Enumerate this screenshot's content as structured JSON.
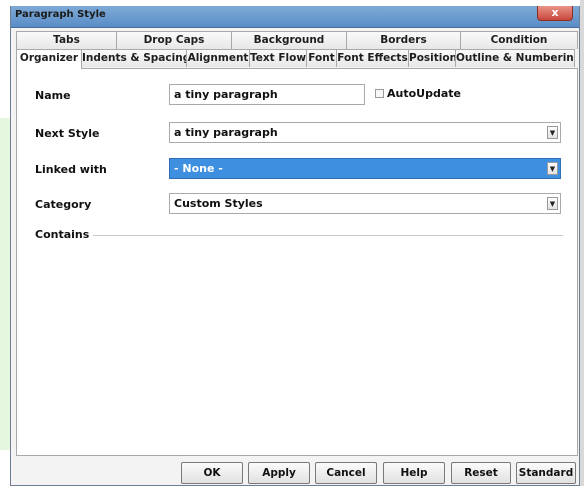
{
  "window": {
    "title": "Paragraph Style",
    "close_label": "x"
  },
  "tabs": {
    "back_row": [
      "Tabs",
      "Drop Caps",
      "Background",
      "Borders",
      "Condition"
    ],
    "front_row": [
      "Organizer",
      "Indents & Spacing",
      "Alignment",
      "Text Flow",
      "Font",
      "Font Effects",
      "Position",
      "Outline & Numbering"
    ],
    "active": "Organizer"
  },
  "form": {
    "name_label": "Name",
    "name_value": "a tiny paragraph",
    "autoupdate_label": "AutoUpdate",
    "autoupdate_checked": false,
    "next_style_label": "Next Style",
    "next_style_value": "a tiny paragraph",
    "linked_with_label": "Linked with",
    "linked_with_value": "- None -",
    "category_label": "Category",
    "category_value": "Custom Styles",
    "contains_label": "Contains"
  },
  "buttons": {
    "ok": "OK",
    "apply": "Apply",
    "cancel": "Cancel",
    "help": "Help",
    "reset": "Reset",
    "standard": "Standard"
  },
  "colors": {
    "title_bar": "#5a8dc7",
    "selected_field": "#3f8fe0",
    "close_button": "#c8483a"
  }
}
